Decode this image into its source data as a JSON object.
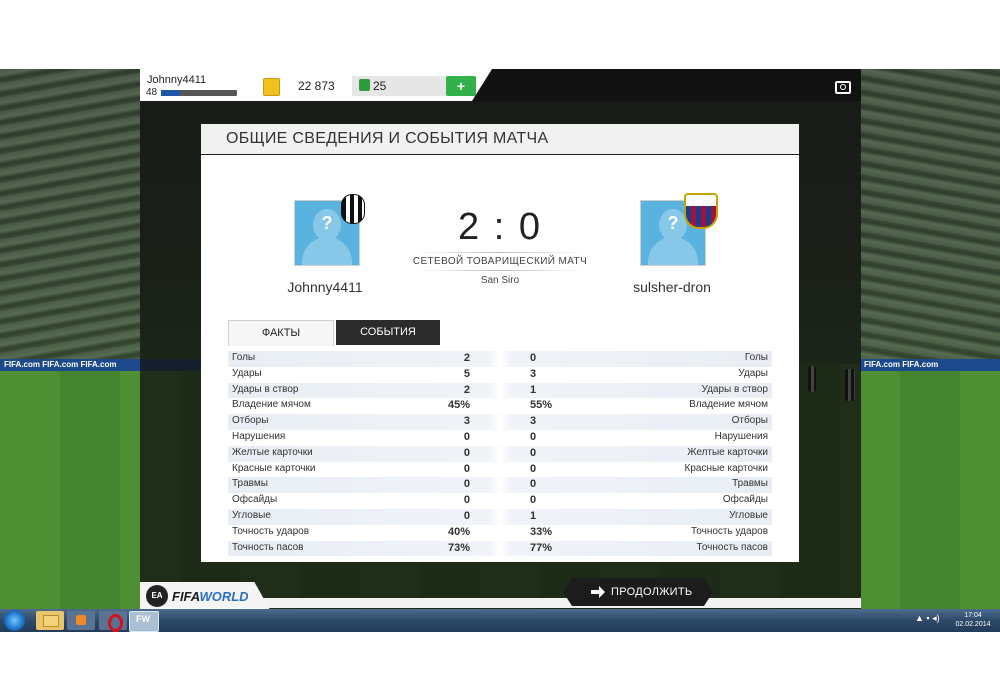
{
  "topbar": {
    "username": "Johnny4411",
    "level": "48",
    "xp_progress": 0.25,
    "coins": "22 873",
    "points": "25",
    "add_label": "+"
  },
  "panel": {
    "title": "ОБЩИЕ СВЕДЕНИЯ И СОБЫТИЯ МАТЧА"
  },
  "match": {
    "home": "Johnny4411",
    "away": "sulsher-dron",
    "score": "2 : 0",
    "type": "СЕТЕВОЙ ТОВАРИЩЕСКИЙ МАТЧ",
    "venue": "San Siro",
    "avatar_placeholder": "?"
  },
  "tabs": {
    "facts": "ФАКТЫ",
    "events": "СОБЫТИЯ"
  },
  "stats": [
    {
      "label": "Голы",
      "home": "2",
      "away": "0"
    },
    {
      "label": "Удары",
      "home": "5",
      "away": "3"
    },
    {
      "label": "Удары в створ",
      "home": "2",
      "away": "1"
    },
    {
      "label": "Владение мячом",
      "home": "45%",
      "away": "55%"
    },
    {
      "label": "Отборы",
      "home": "3",
      "away": "3"
    },
    {
      "label": "Нарушения",
      "home": "0",
      "away": "0"
    },
    {
      "label": "Желтые карточки",
      "home": "0",
      "away": "0"
    },
    {
      "label": "Красные карточки",
      "home": "0",
      "away": "0"
    },
    {
      "label": "Травмы",
      "home": "0",
      "away": "0"
    },
    {
      "label": "Офсайды",
      "home": "0",
      "away": "0"
    },
    {
      "label": "Угловые",
      "home": "0",
      "away": "1"
    },
    {
      "label": "Точность ударов",
      "home": "40%",
      "away": "33%"
    },
    {
      "label": "Точность пасов",
      "home": "73%",
      "away": "77%"
    }
  ],
  "continue_label": "ПРОДОЛЖИТЬ",
  "logo": {
    "ea": "EA",
    "fifa": "FIFA",
    "world": "WORLD"
  },
  "ads": {
    "left": "FIFA.com    FIFA.com    FIFA.com",
    "right": "FIFA.com  FIFA.com"
  },
  "taskbar": {
    "fifa_label": "FW",
    "time": "17:04",
    "date": "02.02.2014"
  },
  "colors": {
    "accent_green": "#32b14a",
    "accent_blue": "#1e56a8",
    "coin_gold": "#f1c21d"
  }
}
